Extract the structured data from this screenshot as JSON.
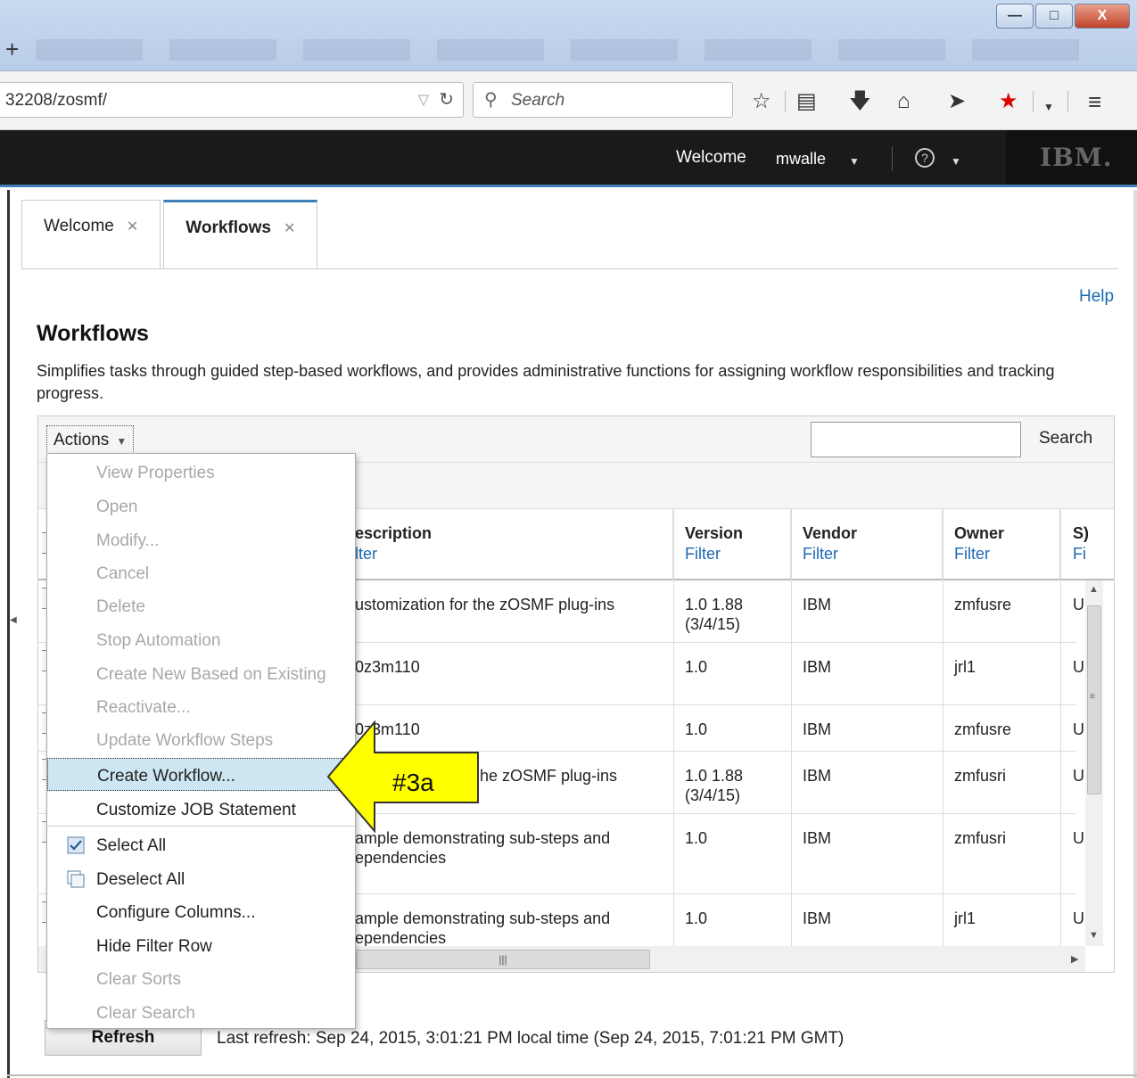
{
  "browser": {
    "new_tab_symbol": "+",
    "url": "32208/zosmf/",
    "search_placeholder": "Search",
    "window_buttons": [
      "minimize-icon",
      "maximize-icon",
      "close-icon"
    ],
    "toolbar_icons": [
      "bookmark-star-icon",
      "reading-list-icon",
      "download-icon",
      "home-icon",
      "send-icon",
      "red-star-icon",
      "menu-hamburger-icon"
    ]
  },
  "header": {
    "welcome": "Welcome",
    "user": "mwalle",
    "brand": "IBM."
  },
  "tabs": [
    {
      "label": "Welcome",
      "active": false
    },
    {
      "label": "Workflows",
      "active": true
    }
  ],
  "page": {
    "help_link": "Help",
    "title": "Workflows",
    "description": "Simplifies tasks through guided step-based workflows, and provides administrative functions for assigning workflow responsibilities and tracking progress."
  },
  "toolbar": {
    "actions_label": "Actions",
    "search_value": "",
    "search_button": "Search"
  },
  "columns": [
    {
      "header": "escription",
      "filter": "lter"
    },
    {
      "header": "Version",
      "filter": "Filter"
    },
    {
      "header": "Vendor",
      "filter": "Filter"
    },
    {
      "header": "Owner",
      "filter": "Filter"
    },
    {
      "header": "S)",
      "filter": "Fi"
    }
  ],
  "rows": [
    {
      "description": "ustomization for the zOSMF plug-ins",
      "version": "1.0 1.88\n(3/4/15)",
      "vendor": "IBM",
      "owner": "zmfusre",
      "sys": "U"
    },
    {
      "description": "0z3m110",
      "version": "1.0",
      "vendor": "IBM",
      "owner": "jrl1",
      "sys": "U"
    },
    {
      "description": "0z3m110",
      "version": "1.0",
      "vendor": "IBM",
      "owner": "zmfusre",
      "sys": "U"
    },
    {
      "description": "he zOSMF plug-ins",
      "version": "1.0 1.88\n(3/4/15)",
      "vendor": "IBM",
      "owner": "zmfusri",
      "sys": "U"
    },
    {
      "description": "ample demonstrating sub-steps and\nependencies",
      "version": "1.0",
      "vendor": "IBM",
      "owner": "zmfusri",
      "sys": "U"
    },
    {
      "description": "ample demonstrating sub-steps and\nependencies",
      "version": "1.0",
      "vendor": "IBM",
      "owner": "jrl1",
      "sys": "U"
    }
  ],
  "menu": {
    "items": [
      {
        "label": "View Properties",
        "enabled": false
      },
      {
        "label": "Open",
        "enabled": false
      },
      {
        "label": "Modify...",
        "enabled": false
      },
      {
        "label": "Cancel",
        "enabled": false
      },
      {
        "label": "Delete",
        "enabled": false
      },
      {
        "label": "Stop Automation",
        "enabled": false
      },
      {
        "label": "Create New Based on Existing",
        "enabled": false
      },
      {
        "label": "Reactivate...",
        "enabled": false
      },
      {
        "label": "Update Workflow Steps",
        "enabled": false
      },
      {
        "label": "Create Workflow...",
        "enabled": true,
        "highlighted": true
      },
      {
        "label": "Customize JOB Statement",
        "enabled": true
      },
      {
        "label": "Select All",
        "enabled": true,
        "icon": "checked-checkbox-icon"
      },
      {
        "label": "Deselect All",
        "enabled": true,
        "icon": "unchecked-checkbox-icon"
      },
      {
        "label": "Configure Columns...",
        "enabled": true
      },
      {
        "label": "Hide Filter Row",
        "enabled": true
      },
      {
        "label": "Clear Sorts",
        "enabled": false
      },
      {
        "label": "Clear Search",
        "enabled": false
      }
    ]
  },
  "annotation": {
    "label": "#3a",
    "arrow_color": "#ffff00"
  },
  "footer": {
    "refresh_label": "Refresh",
    "last_refresh": "Last refresh: Sep 24, 2015, 3:01:21 PM local time (Sep 24, 2015, 7:01:21 PM GMT)"
  },
  "colors": {
    "accent": "#3d7fb6",
    "link": "#1c68b4",
    "header_bg": "#1a1a1a",
    "menu_highlight": "#cde6f2"
  }
}
